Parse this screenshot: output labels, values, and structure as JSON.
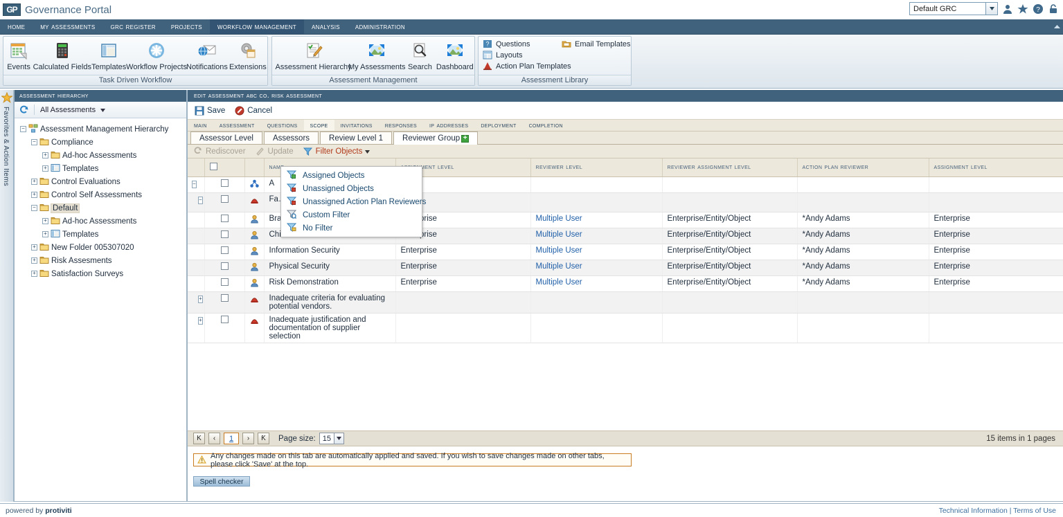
{
  "titlebar": {
    "app_title": "Governance Portal",
    "logo_text": "GP",
    "grc_selector_value": "Default GRC",
    "icons": [
      "user-icon",
      "star-icon",
      "help-icon",
      "lock-icon"
    ]
  },
  "menubar": {
    "items": [
      {
        "label": "Home",
        "active": false
      },
      {
        "label": "My Assessments",
        "active": false
      },
      {
        "label": "GRC Register",
        "active": false
      },
      {
        "label": "Projects",
        "active": false
      },
      {
        "label": "Workflow Management",
        "active": true
      },
      {
        "label": "Analysis",
        "active": false
      },
      {
        "label": "Administration",
        "active": false
      }
    ]
  },
  "ribbon": {
    "groups": [
      {
        "label": "Task Driven Workflow",
        "buttons": [
          {
            "label": "Events",
            "icon": "calendar-icon"
          },
          {
            "label": "Calculated Fields",
            "icon": "calculator-icon"
          },
          {
            "label": "Templates",
            "icon": "template-window-icon"
          },
          {
            "label": "Workflow Projects",
            "icon": "asterisk-burst-icon"
          },
          {
            "label": "Notifications",
            "icon": "envelope-globe-icon"
          },
          {
            "label": "Extensions",
            "icon": "gear-icon"
          }
        ]
      },
      {
        "label": "Assessment Management",
        "buttons": [
          {
            "label": "Assessment Hierarchy",
            "icon": "checklist-pencil-icon"
          },
          {
            "label": "My Assessments",
            "icon": "picture-frame-icon"
          },
          {
            "label": "Search",
            "icon": "magnifier-page-icon"
          },
          {
            "label": "Dashboard",
            "icon": "picture-frame-icon"
          }
        ]
      },
      {
        "label": "Assessment Library",
        "links": [
          {
            "label": "Questions",
            "icon": "question-box-icon"
          },
          {
            "label": "Layouts",
            "icon": "layout-icon"
          },
          {
            "label": "Action Plan Templates",
            "icon": "pdf-icon"
          },
          {
            "label": "Email Templates",
            "icon": "folder-mail-icon"
          }
        ]
      }
    ]
  },
  "favbar": {
    "label": "Favorites & Action Items",
    "icon": "star-icon"
  },
  "left_panel": {
    "header": "Assessment Hierarchy",
    "refresh_icon": "refresh-icon",
    "scope_label": "All Assessments",
    "tree": [
      {
        "label": "Assessment Management Hierarchy",
        "depth": 0,
        "toggle": "minus",
        "icon": "hierarchy-icon",
        "selected": false
      },
      {
        "label": "Compliance",
        "depth": 1,
        "toggle": "minus",
        "icon": "folder-icon",
        "selected": false
      },
      {
        "label": "Ad-hoc Assessments",
        "depth": 2,
        "toggle": "plus",
        "icon": "folder-icon",
        "selected": false
      },
      {
        "label": "Templates",
        "depth": 2,
        "toggle": "plus",
        "icon": "template-icon",
        "selected": false
      },
      {
        "label": "Control Evaluations",
        "depth": 1,
        "toggle": "plus",
        "icon": "folder-icon",
        "selected": false
      },
      {
        "label": "Control Self Assessments",
        "depth": 1,
        "toggle": "plus",
        "icon": "folder-icon",
        "selected": false
      },
      {
        "label": "Default",
        "depth": 1,
        "toggle": "minus",
        "icon": "folder-icon",
        "selected": true
      },
      {
        "label": "Ad-hoc Assessments",
        "depth": 2,
        "toggle": "plus",
        "icon": "folder-icon",
        "selected": false
      },
      {
        "label": "Templates",
        "depth": 2,
        "toggle": "plus",
        "icon": "template-icon",
        "selected": false
      },
      {
        "label": "New Folder 005307020",
        "depth": 1,
        "toggle": "plus",
        "icon": "folder-icon",
        "selected": false
      },
      {
        "label": "Risk Assesments",
        "depth": 1,
        "toggle": "plus",
        "icon": "folder-icon",
        "selected": false
      },
      {
        "label": "Satisfaction Surveys",
        "depth": 1,
        "toggle": "plus",
        "icon": "folder-icon",
        "selected": false
      }
    ]
  },
  "right_panel": {
    "header": "Edit assessment ABC Co. Risk Assessment",
    "toolbar": [
      {
        "label": "Save",
        "icon": "save-icon"
      },
      {
        "label": "Cancel",
        "icon": "cancel-icon"
      }
    ],
    "main_tabs": [
      {
        "label": "Main",
        "active": false
      },
      {
        "label": "Assessment",
        "active": false
      },
      {
        "label": "Questions",
        "active": false
      },
      {
        "label": "Scope",
        "active": true
      },
      {
        "label": "Invitations",
        "active": false
      },
      {
        "label": "Responses",
        "active": false
      },
      {
        "label": "IP addresses",
        "active": false
      },
      {
        "label": "Deployment",
        "active": false
      },
      {
        "label": "Completion",
        "active": false
      }
    ],
    "sub_tabs": [
      {
        "label": "Assessor Level",
        "active": false,
        "badge": ""
      },
      {
        "label": "Assessors",
        "active": false,
        "badge": ""
      },
      {
        "label": "Review Level 1",
        "active": false,
        "badge": ""
      },
      {
        "label": "Reviewer Group",
        "active": true,
        "badge": "+"
      }
    ],
    "grid_toolbar": [
      {
        "label": "Rediscover",
        "icon": "rediscover-icon",
        "state": "disabled"
      },
      {
        "label": "Update",
        "icon": "pencil-icon",
        "state": "disabled"
      },
      {
        "label": "Filter Objects",
        "icon": "filter-icon",
        "state": "active"
      }
    ]
  },
  "filter_dropdown": {
    "open": true,
    "items": [
      {
        "label": "Assigned Objects",
        "icon": "filter-assigned-icon"
      },
      {
        "label": "Unassigned Objects",
        "icon": "filter-unassigned-icon"
      },
      {
        "label": "Unassigned Action Plan Reviewers",
        "icon": "filter-unassigned-icon"
      },
      {
        "label": "Custom Filter",
        "icon": "filter-custom-icon"
      },
      {
        "label": "No Filter",
        "icon": "filter-none-icon"
      }
    ]
  },
  "grid": {
    "columns": [
      {
        "key": "expander",
        "label": ""
      },
      {
        "key": "check",
        "label": ""
      },
      {
        "key": "typeicon",
        "label": ""
      },
      {
        "key": "name",
        "label": "Name"
      },
      {
        "key": "assignment_level",
        "label": "Assignment Level"
      },
      {
        "key": "reviewer_level",
        "label": "Reviewer Level"
      },
      {
        "key": "reviewer_assignment_level",
        "label": "Reviewer Assignment Level"
      },
      {
        "key": "action_plan_reviewer",
        "label": "Action Plan Reviewer"
      },
      {
        "key": "assignment_level_2",
        "label": "Assignment Level"
      }
    ],
    "header_select_all": false,
    "rows": [
      {
        "depth": 0,
        "toggle": "minus",
        "checked": false,
        "icon": "entity-blue-icon",
        "name": "A",
        "assignment_level": "",
        "reviewer_level": "",
        "reviewer_assignment_level": "",
        "action_plan_reviewer": "",
        "assignment_level_2": "",
        "alt": false,
        "tall": false
      },
      {
        "depth": 1,
        "toggle": "minus",
        "checked": false,
        "icon": "risk-red-icon",
        "name": "Fa… re…",
        "assignment_level": "",
        "reviewer_level": "",
        "reviewer_assignment_level": "",
        "action_plan_reviewer": "",
        "assignment_level_2": "",
        "alt": true,
        "tall": true
      },
      {
        "depth": 2,
        "toggle": "",
        "checked": false,
        "icon": "user-gold-icon",
        "name": "Branch Manager",
        "assignment_level": "Enterprise",
        "reviewer_level": "Multiple User",
        "reviewer_assignment_level": "Enterprise/Entity/Object",
        "action_plan_reviewer": "*Andy Adams",
        "assignment_level_2": "Enterprise",
        "alt": false,
        "tall": false
      },
      {
        "depth": 2,
        "toggle": "",
        "checked": false,
        "icon": "user-gold-icon",
        "name": "Chief Risk Officer",
        "assignment_level": "Enterprise",
        "reviewer_level": "Multiple User",
        "reviewer_assignment_level": "Enterprise/Entity/Object",
        "action_plan_reviewer": "*Andy Adams",
        "assignment_level_2": "Enterprise",
        "alt": true,
        "tall": false
      },
      {
        "depth": 2,
        "toggle": "",
        "checked": false,
        "icon": "user-gold-icon",
        "name": "Information Security",
        "assignment_level": "Enterprise",
        "reviewer_level": "Multiple User",
        "reviewer_assignment_level": "Enterprise/Entity/Object",
        "action_plan_reviewer": "*Andy Adams",
        "assignment_level_2": "Enterprise",
        "alt": false,
        "tall": false
      },
      {
        "depth": 2,
        "toggle": "",
        "checked": false,
        "icon": "user-gold-icon",
        "name": "Physical Security",
        "assignment_level": "Enterprise",
        "reviewer_level": "Multiple User",
        "reviewer_assignment_level": "Enterprise/Entity/Object",
        "action_plan_reviewer": "*Andy Adams",
        "assignment_level_2": "Enterprise",
        "alt": true,
        "tall": false
      },
      {
        "depth": 2,
        "toggle": "",
        "checked": false,
        "icon": "user-gold-icon",
        "name": "Risk Demonstration",
        "assignment_level": "Enterprise",
        "reviewer_level": "Multiple User",
        "reviewer_assignment_level": "Enterprise/Entity/Object",
        "action_plan_reviewer": "*Andy Adams",
        "assignment_level_2": "Enterprise",
        "alt": false,
        "tall": false
      },
      {
        "depth": 1,
        "toggle": "plus",
        "checked": false,
        "icon": "risk-red-icon",
        "name": "Inadequate criteria for evaluating potential vendors.",
        "assignment_level": "",
        "reviewer_level": "",
        "reviewer_assignment_level": "",
        "action_plan_reviewer": "",
        "assignment_level_2": "",
        "alt": true,
        "tall": true
      },
      {
        "depth": 1,
        "toggle": "plus",
        "checked": false,
        "icon": "risk-red-icon",
        "name": "Inadequate justification and documentation of supplier selection",
        "assignment_level": "",
        "reviewer_level": "",
        "reviewer_assignment_level": "",
        "action_plan_reviewer": "",
        "assignment_level_2": "",
        "alt": false,
        "tall": true
      }
    ]
  },
  "pager": {
    "first_label": "K",
    "prev_label": "‹",
    "current_page": "1",
    "next_label": "›",
    "last_label": "Ƙ",
    "page_size_label": "Page size:",
    "page_size_value": "15",
    "items_text": "15 items in 1 pages"
  },
  "notice": {
    "icon": "warning-icon",
    "text": "Any changes made on this tab are automatically applied and saved. If you wish to save changes made on other tabs, please click 'Save' at the top."
  },
  "spell_checker": {
    "label": "Spell checker"
  },
  "footer": {
    "powered_prefix": "powered by ",
    "powered_brand": "protiviti",
    "links": "Technical Information | Terms of Use"
  },
  "colors": {
    "header_blue": "#41627d",
    "tab_cream": "#ede8dc",
    "accent_orange": "#c87b20",
    "link_blue": "#1f5fa8",
    "filter_red": "#b03a1a",
    "green_badge": "#3fa43f"
  }
}
